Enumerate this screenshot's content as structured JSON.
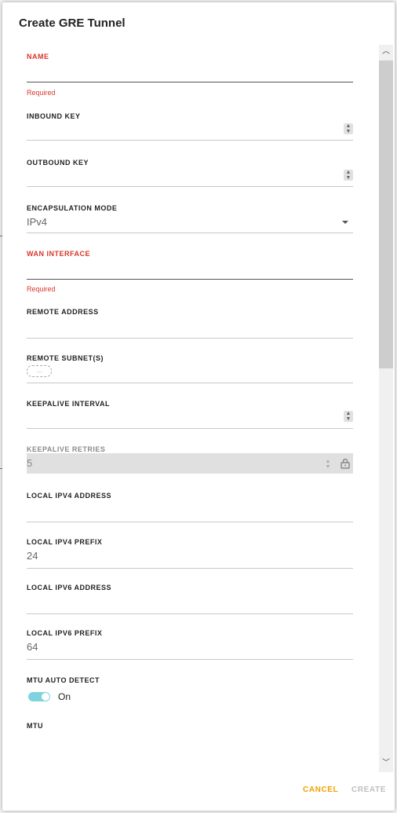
{
  "dialog": {
    "title": "Create GRE Tunnel",
    "fields": {
      "name": {
        "label": "NAME",
        "helper": "Required",
        "value": ""
      },
      "inbound_key": {
        "label": "INBOUND KEY",
        "value": ""
      },
      "outbound_key": {
        "label": "OUTBOUND KEY",
        "value": ""
      },
      "encapsulation_mode": {
        "label": "ENCAPSULATION MODE",
        "value": "IPv4"
      },
      "wan_interface": {
        "label": "WAN INTERFACE",
        "helper": "Required",
        "value": ""
      },
      "remote_address": {
        "label": "REMOTE ADDRESS",
        "value": ""
      },
      "remote_subnets": {
        "label": "REMOTE SUBNET(S)",
        "chip_placeholder": "..."
      },
      "keepalive_interval": {
        "label": "KEEPALIVE INTERVAL",
        "value": ""
      },
      "keepalive_retries": {
        "label": "KEEPALIVE RETRIES",
        "value": "5",
        "disabled": true
      },
      "local_ipv4_address": {
        "label": "LOCAL IPV4 ADDRESS",
        "value": ""
      },
      "local_ipv4_prefix": {
        "label": "LOCAL IPV4 PREFIX",
        "value": "24"
      },
      "local_ipv6_address": {
        "label": "LOCAL IPV6 ADDRESS",
        "value": ""
      },
      "local_ipv6_prefix": {
        "label": "LOCAL IPV6 PREFIX",
        "value": "64"
      },
      "mtu_auto_detect": {
        "label": "MTU AUTO DETECT",
        "state_label": "On",
        "enabled": true
      },
      "mtu": {
        "label": "MTU",
        "value": ""
      }
    },
    "actions": {
      "cancel": "CANCEL",
      "create": "CREATE"
    }
  },
  "colors": {
    "error": "#d9362b",
    "accent": "#f2a200",
    "toggle_on": "#7fd3de",
    "disabled_bg": "#e0e0e0"
  }
}
